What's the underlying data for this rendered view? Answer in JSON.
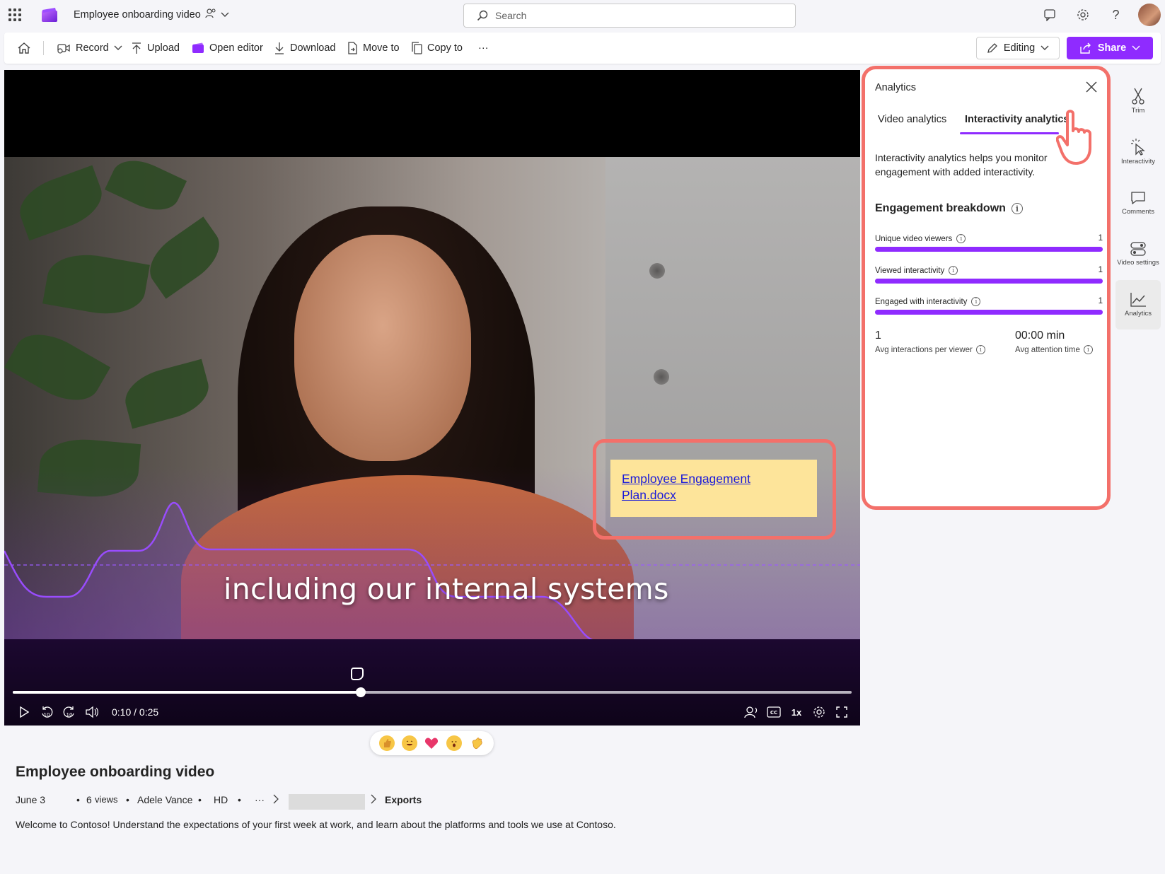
{
  "topbar": {
    "doc_title": "Employee onboarding video",
    "search_placeholder": "Search"
  },
  "toolbar": {
    "record": "Record",
    "upload": "Upload",
    "open_editor": "Open editor",
    "download": "Download",
    "move_to": "Move to",
    "copy_to": "Copy to",
    "more": "···",
    "editing": "Editing",
    "share": "Share"
  },
  "video": {
    "caption": "including our internal systems",
    "link_text_line1": "Employee Engagement ",
    "link_text_line2": "Plan.docx",
    "time": "0:10 / 0:25",
    "progress": 0.415,
    "speed": "1x",
    "skip_back": "10",
    "skip_forward": "10"
  },
  "analytics": {
    "title": "Analytics",
    "tabs": [
      {
        "label": "Video analytics",
        "active": false
      },
      {
        "label": "Interactivity analytics",
        "active": true
      }
    ],
    "description": "Interactivity analytics helps you monitor engagement with added interactivity.",
    "section_title": "Engagement breakdown",
    "metrics": [
      {
        "label": "Unique video viewers",
        "value": "1",
        "fill": 1.0
      },
      {
        "label": "Viewed interactivity",
        "value": "1",
        "fill": 1.0
      },
      {
        "label": "Engaged with interactivity",
        "value": "1",
        "fill": 1.0
      }
    ],
    "stats": [
      {
        "value": "1",
        "label": "Avg interactions per viewer"
      },
      {
        "value": "00:00 min",
        "label": "Avg attention time"
      }
    ]
  },
  "rail": [
    {
      "label": "Trim",
      "icon": "scissors-icon"
    },
    {
      "label": "Interactivity",
      "icon": "interactivity-icon"
    },
    {
      "label": "Comments",
      "icon": "comment-icon"
    },
    {
      "label": "Video settings",
      "icon": "video-settings-icon"
    },
    {
      "label": "Analytics",
      "icon": "analytics-icon",
      "active": true
    }
  ],
  "meta": {
    "title": "Employee onboarding video",
    "date": "June 3",
    "views_count": "6",
    "views_label": "views",
    "author": "Adele Vance",
    "quality": "HD",
    "breadcrumb_more": "···",
    "folder": "Exports",
    "description": "Welcome to Contoso! Understand the expectations of your first week at work, and learn about the platforms and tools we use at Contoso."
  },
  "colors": {
    "accent": "#8f2bff",
    "highlight": "#f3706a",
    "link_card": "#fde49a"
  }
}
